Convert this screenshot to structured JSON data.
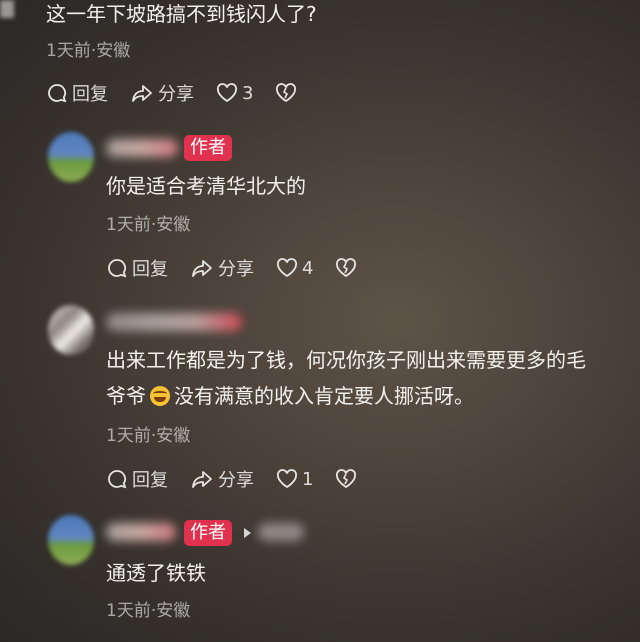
{
  "comments": [
    {
      "text": "这一年下坡路搞不到钱闪人了?",
      "meta": "1天前·安徽",
      "reply": "回复",
      "share": "分享",
      "likes": "3"
    },
    {
      "badge": "作者",
      "text": "你是适合考清华北大的",
      "meta": "1天前·安徽",
      "reply": "回复",
      "share": "分享",
      "likes": "4"
    },
    {
      "text_line1": "出来工作都是为了钱，何况你孩子刚出来需要更多的毛",
      "text_line2_a": "爷爷",
      "text_line2_b": "没有满意的收入肯定要人挪活呀。",
      "meta": "1天前·安徽",
      "reply": "回复",
      "share": "分享",
      "likes": "1"
    },
    {
      "badge": "作者",
      "text": "通透了铁铁",
      "meta": "1天前·安徽"
    }
  ],
  "colors": {
    "badge": "#e0324e"
  }
}
